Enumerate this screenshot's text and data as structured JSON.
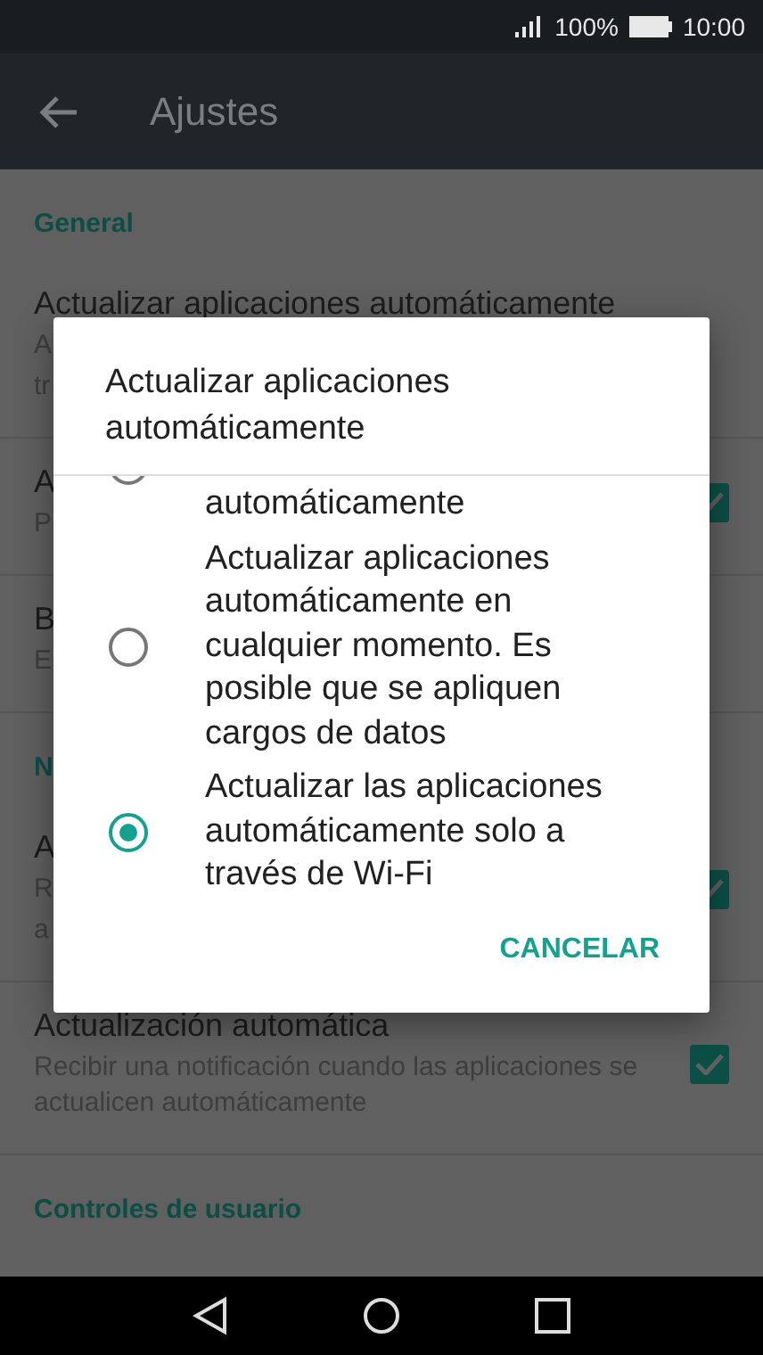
{
  "status_bar": {
    "battery": "100%",
    "time": "10:00"
  },
  "toolbar": {
    "title": "Ajustes"
  },
  "sections": [
    {
      "header": "General",
      "items": [
        {
          "title": "Actualizar aplicaciones automáticamente",
          "summary": [
            "A",
            "tr"
          ]
        },
        {
          "title": "A",
          "summary": [
            "P"
          ],
          "checked": true
        },
        {
          "title": "B",
          "summary": [
            "E"
          ]
        }
      ]
    },
    {
      "header": "N",
      "items": [
        {
          "title": "A",
          "summary": [
            "R",
            "a"
          ],
          "checked": true
        },
        {
          "title": "Actualización automática",
          "summary": [
            "Recibir una notificación cuando las aplicaciones se actualicen automáticamente"
          ],
          "checked": true
        }
      ]
    },
    {
      "header": "Controles de usuario"
    }
  ],
  "dialog": {
    "title": "Actualizar aplicaciones automáticamente",
    "options": [
      {
        "label": "automáticamente",
        "selected": false
      },
      {
        "label": "Actualizar aplicaciones automáticamente en cualquier momento. Es posible que se apliquen cargos de datos",
        "selected": false
      },
      {
        "label": "Actualizar las aplicaciones automáticamente solo a través de Wi-Fi",
        "selected": true
      }
    ],
    "button": "CANCELAR"
  }
}
